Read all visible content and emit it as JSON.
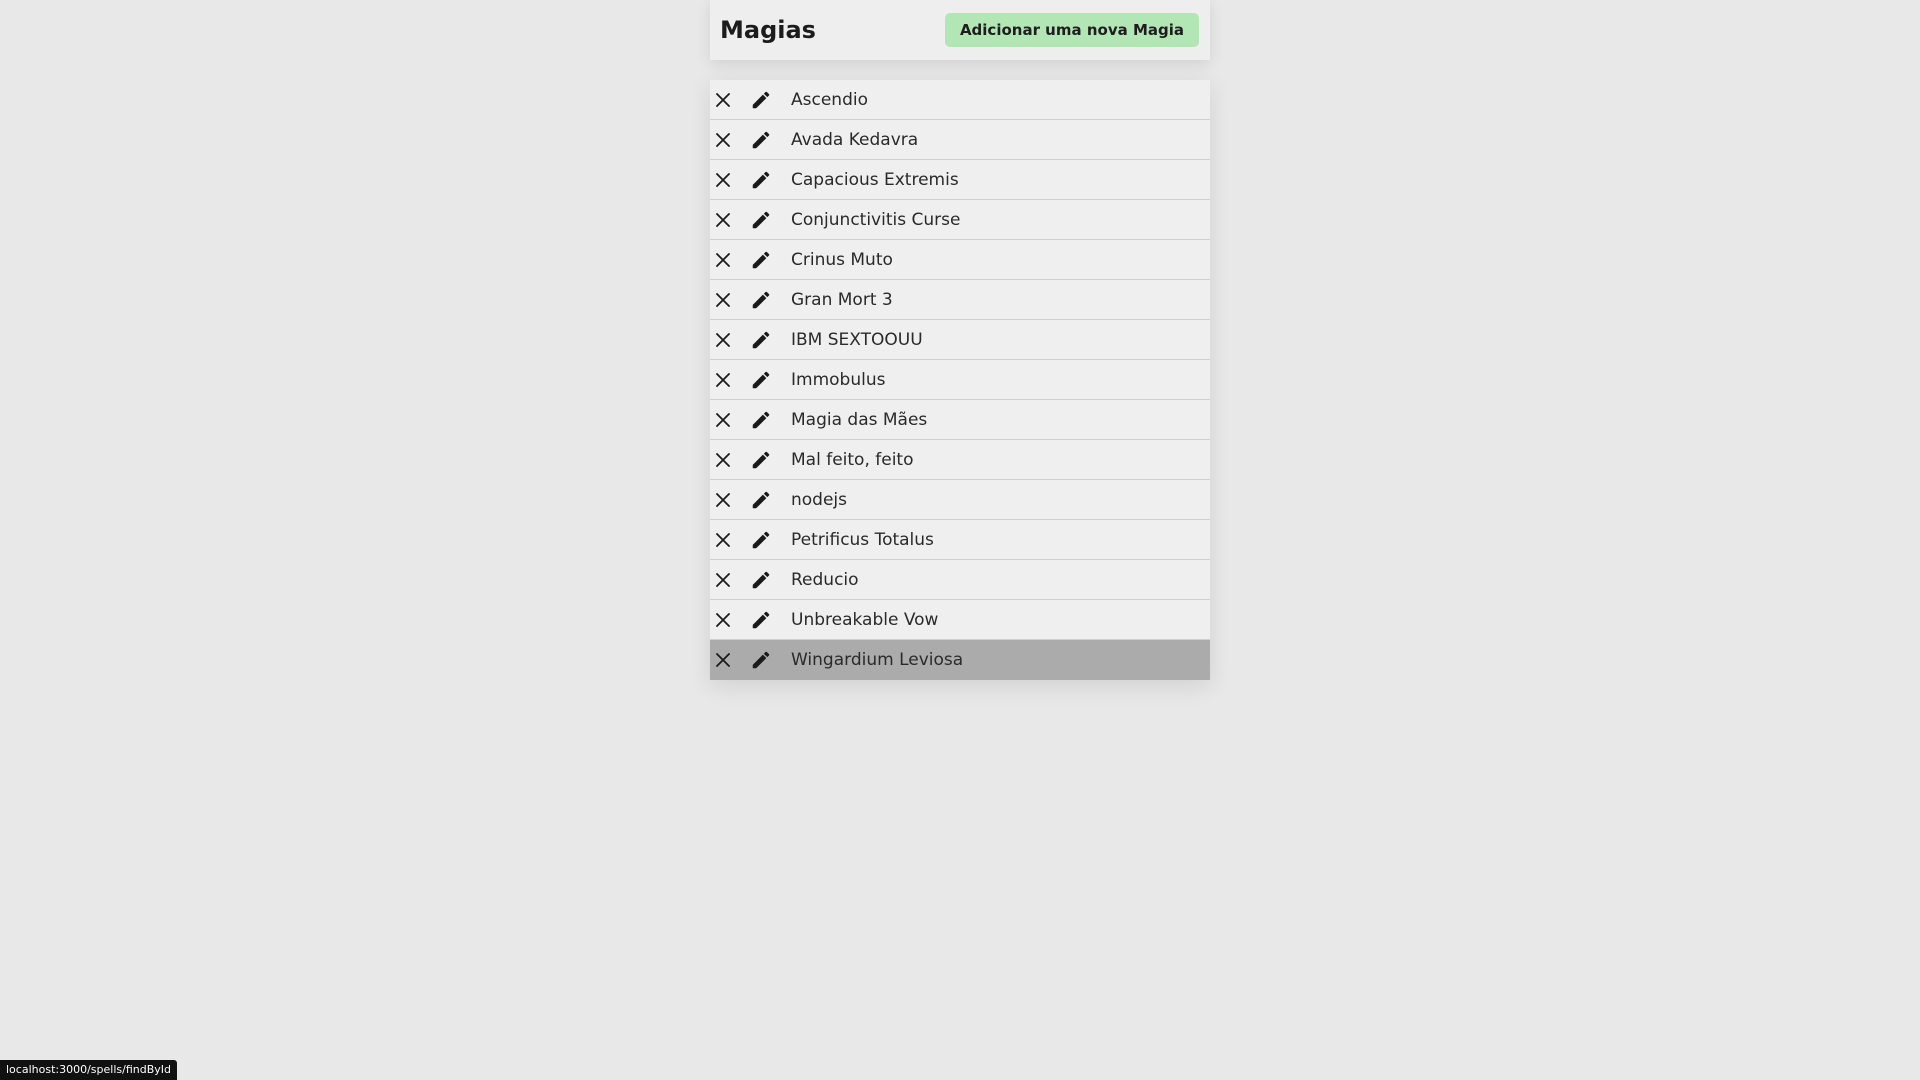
{
  "header": {
    "title": "Magias",
    "add_button_label": "Adicionar uma nova Magia"
  },
  "colors": {
    "background": "#e8e8e8",
    "add_button": "#b3e6b5",
    "hovered_row": "#ababab"
  },
  "icons": {
    "delete": "close-icon",
    "edit": "pencil-icon"
  },
  "spells": [
    {
      "name": "Ascendio"
    },
    {
      "name": "Avada Kedavra"
    },
    {
      "name": "Capacious Extremis"
    },
    {
      "name": "Conjunctivitis Curse"
    },
    {
      "name": "Crinus Muto"
    },
    {
      "name": "Gran Mort 3"
    },
    {
      "name": "IBM SEXTOOUU"
    },
    {
      "name": "Immobulus"
    },
    {
      "name": "Magia das Mães"
    },
    {
      "name": "Mal feito, feito"
    },
    {
      "name": "nodejs"
    },
    {
      "name": "Petrificus Totalus"
    },
    {
      "name": "Reducio"
    },
    {
      "name": "Unbreakable Vow"
    },
    {
      "name": "Wingardium Leviosa",
      "hovered": true
    }
  ],
  "status_bar": {
    "url": "localhost:3000/spells/findById"
  }
}
